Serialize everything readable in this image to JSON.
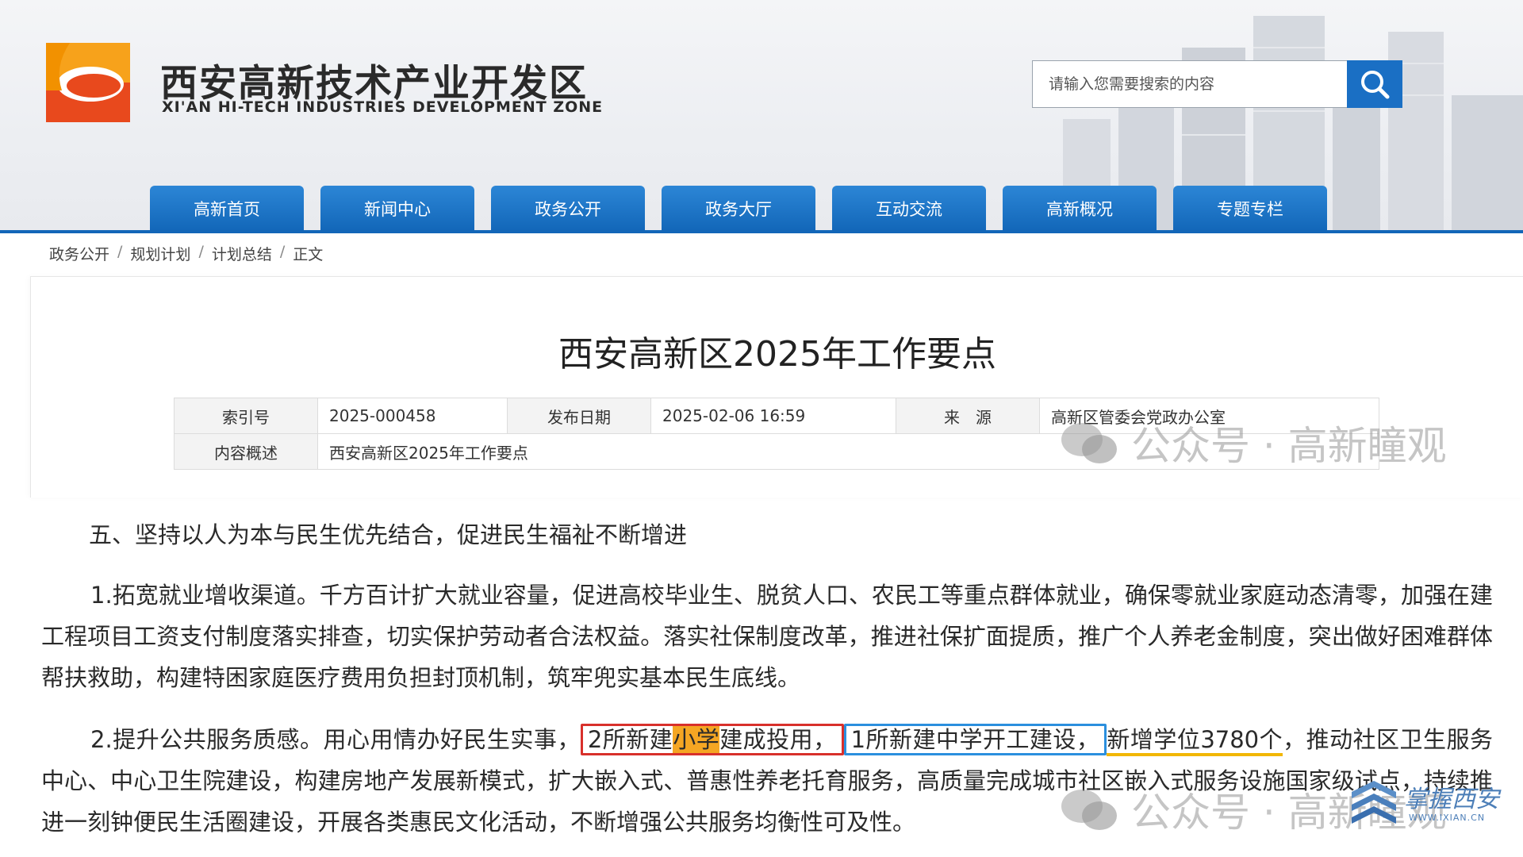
{
  "header": {
    "logo_cn": "西安高新技术产业开发区",
    "logo_en": "XI'AN HI-TECH INDUSTRIES DEVELOPMENT ZONE",
    "search_placeholder": "请输入您需要搜索的内容",
    "brand_color": "#1266b8",
    "logo_colors": [
      "#f29100",
      "#e64a19"
    ]
  },
  "nav": {
    "items": [
      {
        "label": "高新首页"
      },
      {
        "label": "新闻中心"
      },
      {
        "label": "政务公开"
      },
      {
        "label": "政务大厅"
      },
      {
        "label": "互动交流"
      },
      {
        "label": "高新概况"
      },
      {
        "label": "专题专栏"
      }
    ]
  },
  "breadcrumb": {
    "items": [
      "政务公开",
      "规划计划",
      "计划总结",
      "正文"
    ],
    "separator": "/"
  },
  "article": {
    "title": "西安高新区2025年工作要点",
    "meta": {
      "index_label": "索引号",
      "index_value": "2025-000458",
      "date_label": "发布日期",
      "date_value": "2025-02-06 16:59",
      "source_label": "来　源",
      "source_value": "高新区管委会党政办公室",
      "summary_label": "内容概述",
      "summary_value": "西安高新区2025年工作要点"
    },
    "section_title": "五、坚持以人为本与民生优先结合，促进民生福祉不断增进",
    "para1": "1.拓宽就业增收渠道。千方百计扩大就业容量，促进高校毕业生、脱贫人口、农民工等重点群体就业，确保零就业家庭动态清零，加强在建工程项目工资支付制度落实排查，切实保护劳动者合法权益。落实社保制度改革，推进社保扩面提质，推广个人养老金制度，突出做好困难群体帮扶救助，构建特困家庭医疗费用负担封顶机制，筑牢兜实基本民生底线。",
    "para2": {
      "lead": "2.提升公共服务质感。用心用情办好民生实事，",
      "red_part1": "2所新建",
      "red_orange": "小学",
      "red_part2": "建成投用，",
      "blue": "1所新建中学开工建设，",
      "underline": "新增学位3780个",
      "rest": "，推动社区卫生服务中心、中心卫生院建设，构建房地产发展新模式，扩大嵌入式、普惠性养老托育服务，高质量完成城市社区嵌入式服务设施国家级试点，持续推进一刻钟便民生活圈建设，开展各类惠民文化活动，不断增强公共服务均衡性可及性。"
    }
  },
  "watermarks": {
    "text": "公众号 · 高新瞳观",
    "corner_text": "掌握西安",
    "corner_url": "WWW.IXIAN.CN"
  }
}
